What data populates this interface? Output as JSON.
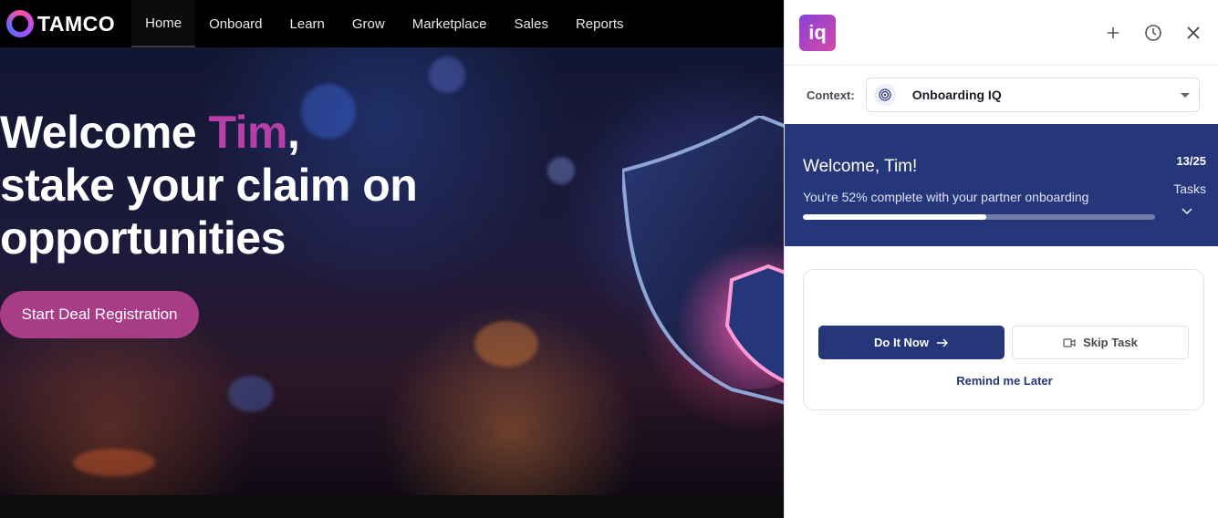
{
  "site": {
    "logo_text": "TAMCO",
    "nav": [
      {
        "label": "Home",
        "active": true
      },
      {
        "label": "Onboard",
        "active": false
      },
      {
        "label": "Learn",
        "active": false
      },
      {
        "label": "Grow",
        "active": false
      },
      {
        "label": "Marketplace",
        "active": false
      },
      {
        "label": "Sales",
        "active": false
      },
      {
        "label": "Reports",
        "active": false
      }
    ],
    "hero": {
      "title_prefix": "Welcome ",
      "title_name": "Tim",
      "title_suffix": ",",
      "title_line2": "stake your claim on",
      "title_line3": "opportunities",
      "cta_label": "Start Deal Registration",
      "name_color": "#b83fa8",
      "cta_color": "#a83c86"
    }
  },
  "panel": {
    "logo_text": "iq",
    "header_icons": [
      "plus-icon",
      "history-icon",
      "close-icon"
    ],
    "context": {
      "label": "Context:",
      "value": "Onboarding IQ",
      "icon": "target-icon"
    },
    "progress": {
      "title": "Welcome, Tim!",
      "subtitle": "You're 52% complete with your partner onboarding",
      "percent": 52,
      "count": "13/25",
      "count_label": "Tasks",
      "bg_color": "#26367a"
    },
    "task": {
      "primary_label": "Do It Now",
      "secondary_label": "Skip Task",
      "link_label": "Remind me Later"
    }
  }
}
